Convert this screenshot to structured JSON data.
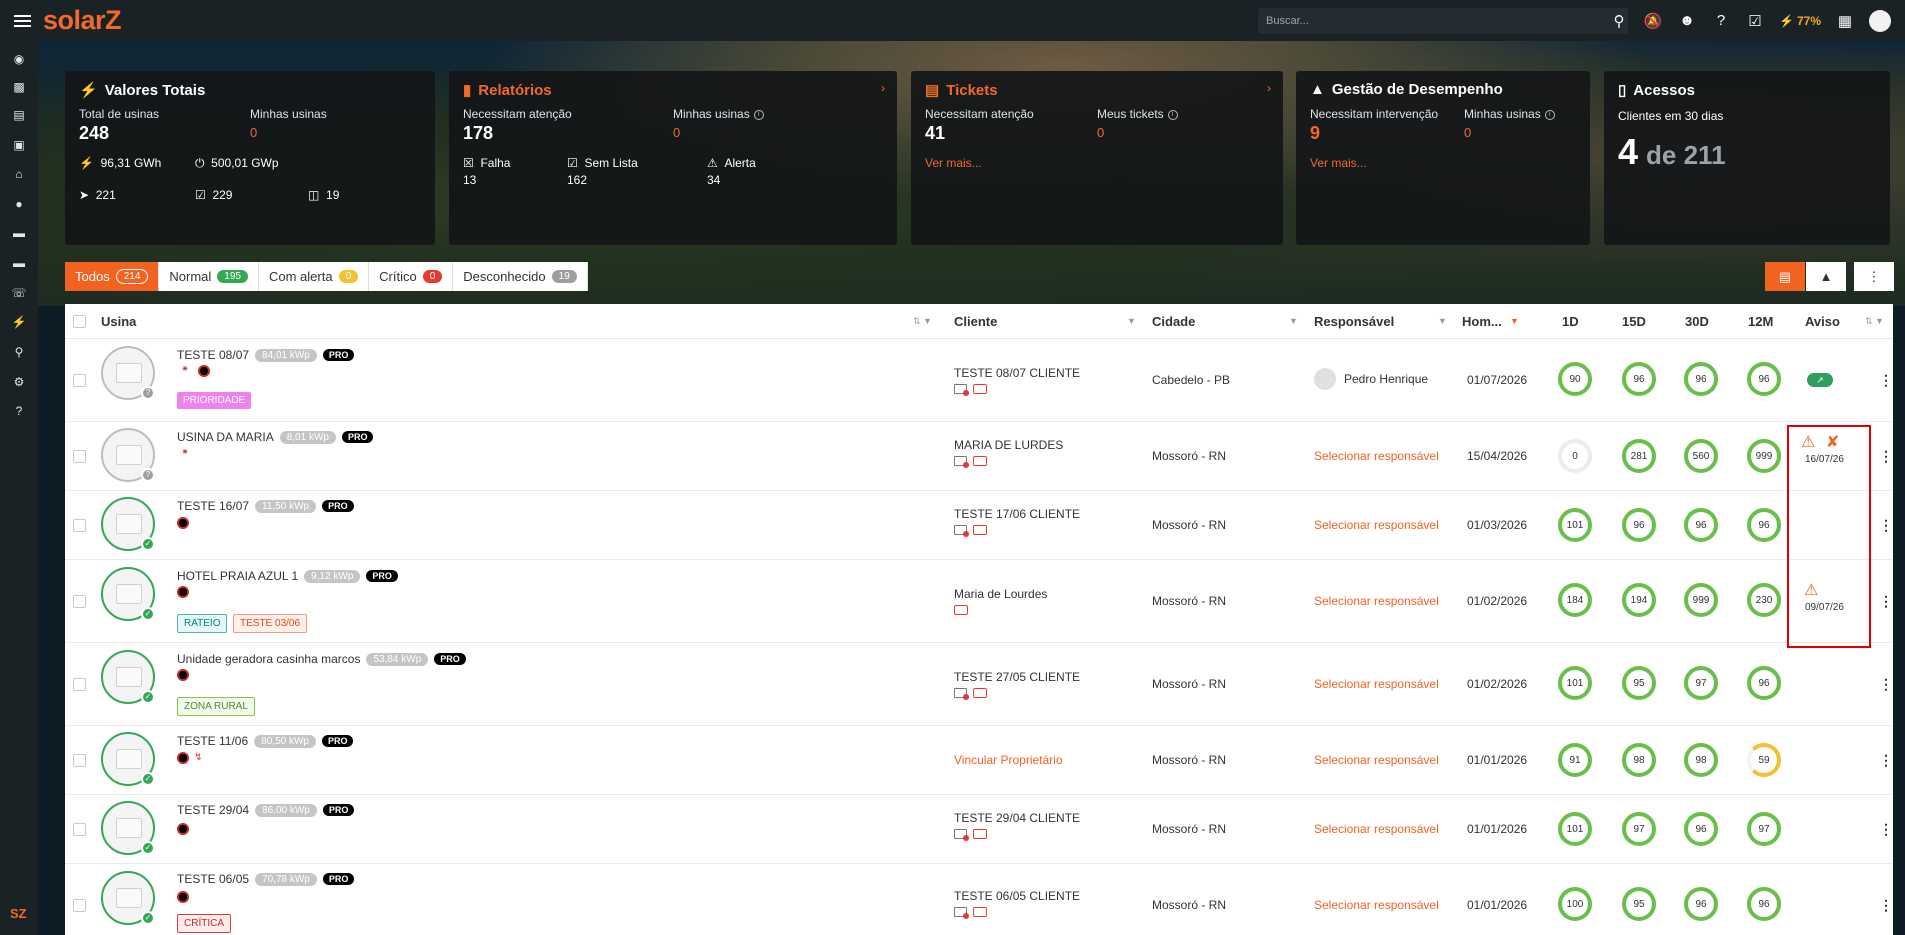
{
  "brand": {
    "logo": "solarZ",
    "footer_logo": "SZ",
    "accent": "#f2692c"
  },
  "topbar": {
    "search_placeholder": "Buscar...",
    "battery": "77%"
  },
  "cards": {
    "totais": {
      "title": "Valores Totais",
      "total_label": "Total de usinas",
      "total": "248",
      "minhas_label": "Minhas usinas",
      "minhas": "0",
      "gwh": "96,31 GWh",
      "gwp": "500,01 GWp",
      "rocket": "221",
      "check": "229",
      "box": "19"
    },
    "relatorios": {
      "title": "Relatórios",
      "atencao_label": "Necessitam atenção",
      "atencao": "178",
      "minhas_label": "Minhas usinas",
      "minhas": "0",
      "falha_label": "Falha",
      "falha": "13",
      "semlista_label": "Sem Lista",
      "semlista": "162",
      "alerta_label": "Alerta",
      "alerta": "34"
    },
    "tickets": {
      "title": "Tickets",
      "atencao_label": "Necessitam atenção",
      "atencao": "41",
      "meus_label": "Meus tickets",
      "meus": "0",
      "link": "Ver mais..."
    },
    "gestao": {
      "title": "Gestão de Desempenho",
      "interv_label": "Necessitam intervenção",
      "interv": "9",
      "minhas_label": "Minhas usinas",
      "minhas": "0",
      "link": "Ver mais..."
    },
    "acessos": {
      "title": "Acessos",
      "sub": "Clientes em 30 dias",
      "num": "4",
      "de": "de 211"
    }
  },
  "filters": [
    {
      "label": "Todos",
      "count": "214"
    },
    {
      "label": "Normal",
      "count": "195"
    },
    {
      "label": "Com alerta",
      "count": "0"
    },
    {
      "label": "Crítico",
      "count": "0"
    },
    {
      "label": "Desconhecido",
      "count": "19"
    }
  ],
  "table": {
    "headers": {
      "usina": "Usina",
      "cliente": "Cliente",
      "cidade": "Cidade",
      "responsavel": "Responsável",
      "hom": "Hom...",
      "d1": "1D",
      "d15": "15D",
      "d30": "30D",
      "m12": "12M",
      "aviso": "Aviso"
    },
    "rows": [
      {
        "name": "TESTE 08/07",
        "kwp": "84,01 kWp",
        "pro": "PRO",
        "tag": "PRIORIDADE",
        "cliente": "TESTE 08/07 CLIENTE",
        "cidade": "Cabedelo - PB",
        "resp": "Pedro Henrique",
        "hom": "01/07/2026",
        "d1": "90",
        "d15": "96",
        "d30": "96",
        "m12": "96"
      },
      {
        "name": "USINA DA MARIA",
        "kwp": "8,01 kWp",
        "pro": "PRO",
        "cliente": "MARIA DE LURDES",
        "cidade": "Mossoró - RN",
        "resp": "Selecionar responsável",
        "hom": "15/04/2026",
        "d1": "0",
        "d15": "281",
        "d30": "560",
        "m12": "999",
        "aviso_date": "16/07/26"
      },
      {
        "name": "TESTE 16/07",
        "kwp": "11,50 kWp",
        "pro": "PRO",
        "cliente": "TESTE 17/06 CLIENTE",
        "cidade": "Mossoró - RN",
        "resp": "Selecionar responsável",
        "hom": "01/03/2026",
        "d1": "101",
        "d15": "96",
        "d30": "96",
        "m12": "96"
      },
      {
        "name": "HOTEL PRAIA AZUL 1",
        "kwp": "9,12 kWp",
        "pro": "PRO",
        "tag": "RATEIO",
        "tag2": "TESTE 03/06",
        "cliente": "Maria de Lourdes",
        "cidade": "Mossoró - RN",
        "resp": "Selecionar responsável",
        "hom": "01/02/2026",
        "d1": "184",
        "d15": "194",
        "d30": "999",
        "m12": "230",
        "aviso_date": "09/07/26"
      },
      {
        "name": "Unidade geradora casinha marcos",
        "kwp": "53,84 kWp",
        "pro": "PRO",
        "tag": "ZONA RURAL",
        "cliente": "TESTE 27/05 CLIENTE",
        "cidade": "Mossoró - RN",
        "resp": "Selecionar responsável",
        "hom": "01/02/2026",
        "d1": "101",
        "d15": "95",
        "d30": "97",
        "m12": "96"
      },
      {
        "name": "TESTE 11/06",
        "kwp": "80,50 kWp",
        "pro": "PRO",
        "cliente": "Vincular Proprietário",
        "cidade": "Mossoró - RN",
        "resp": "Selecionar responsável",
        "hom": "01/01/2026",
        "d1": "91",
        "d15": "98",
        "d30": "98",
        "m12": "59"
      },
      {
        "name": "TESTE 29/04",
        "kwp": "86,00 kWp",
        "pro": "PRO",
        "cliente": "TESTE 29/04 CLIENTE",
        "cidade": "Mossoró - RN",
        "resp": "Selecionar responsável",
        "hom": "01/01/2026",
        "d1": "101",
        "d15": "97",
        "d30": "96",
        "m12": "97"
      },
      {
        "name": "TESTE 06/05",
        "kwp": "70,78 kWp",
        "pro": "PRO",
        "tag": "CRÍTICA",
        "cliente": "TESTE 06/05 CLIENTE",
        "cidade": "Mossoró - RN",
        "resp": "Selecionar responsável",
        "hom": "01/01/2026",
        "d1": "100",
        "d15": "95",
        "d30": "96",
        "m12": "96"
      }
    ]
  }
}
